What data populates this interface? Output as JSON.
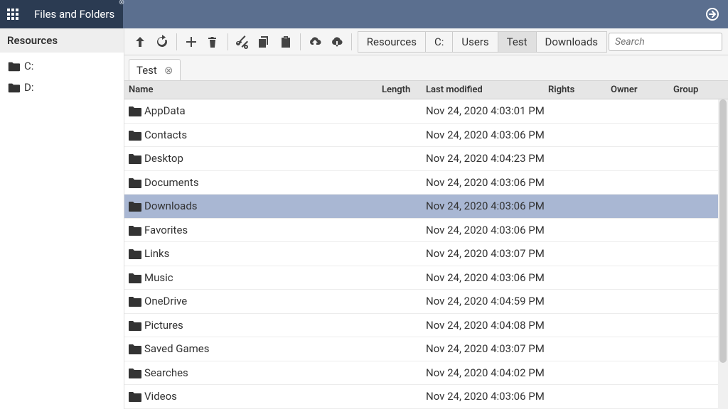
{
  "header": {
    "app_title": "Files and Folders"
  },
  "sidebar": {
    "title": "Resources",
    "items": [
      {
        "label": "C:"
      },
      {
        "label": "D:"
      }
    ]
  },
  "toolbar": {
    "search_placeholder": "Search"
  },
  "breadcrumbs": [
    {
      "label": "Resources",
      "active": false
    },
    {
      "label": "C:",
      "active": false
    },
    {
      "label": "Users",
      "active": false
    },
    {
      "label": "Test",
      "active": true
    },
    {
      "label": "Downloads",
      "active": false
    }
  ],
  "tabs": [
    {
      "label": "Test"
    }
  ],
  "columns": {
    "name": "Name",
    "length": "Length",
    "modified": "Last modified",
    "rights": "Rights",
    "owner": "Owner",
    "group": "Group"
  },
  "rows": [
    {
      "name": "AppData",
      "length": "",
      "modified": "Nov 24, 2020 4:03:01 PM",
      "selected": false
    },
    {
      "name": "Contacts",
      "length": "",
      "modified": "Nov 24, 2020 4:03:06 PM",
      "selected": false
    },
    {
      "name": "Desktop",
      "length": "",
      "modified": "Nov 24, 2020 4:04:23 PM",
      "selected": false
    },
    {
      "name": "Documents",
      "length": "",
      "modified": "Nov 24, 2020 4:03:06 PM",
      "selected": false
    },
    {
      "name": "Downloads",
      "length": "",
      "modified": "Nov 24, 2020 4:03:06 PM",
      "selected": true
    },
    {
      "name": "Favorites",
      "length": "",
      "modified": "Nov 24, 2020 4:03:06 PM",
      "selected": false
    },
    {
      "name": "Links",
      "length": "",
      "modified": "Nov 24, 2020 4:03:07 PM",
      "selected": false
    },
    {
      "name": "Music",
      "length": "",
      "modified": "Nov 24, 2020 4:03:06 PM",
      "selected": false
    },
    {
      "name": "OneDrive",
      "length": "",
      "modified": "Nov 24, 2020 4:04:59 PM",
      "selected": false
    },
    {
      "name": "Pictures",
      "length": "",
      "modified": "Nov 24, 2020 4:04:08 PM",
      "selected": false
    },
    {
      "name": "Saved Games",
      "length": "",
      "modified": "Nov 24, 2020 4:03:07 PM",
      "selected": false
    },
    {
      "name": "Searches",
      "length": "",
      "modified": "Nov 24, 2020 4:04:02 PM",
      "selected": false
    },
    {
      "name": "Videos",
      "length": "",
      "modified": "Nov 24, 2020 4:03:06 PM",
      "selected": false
    }
  ]
}
